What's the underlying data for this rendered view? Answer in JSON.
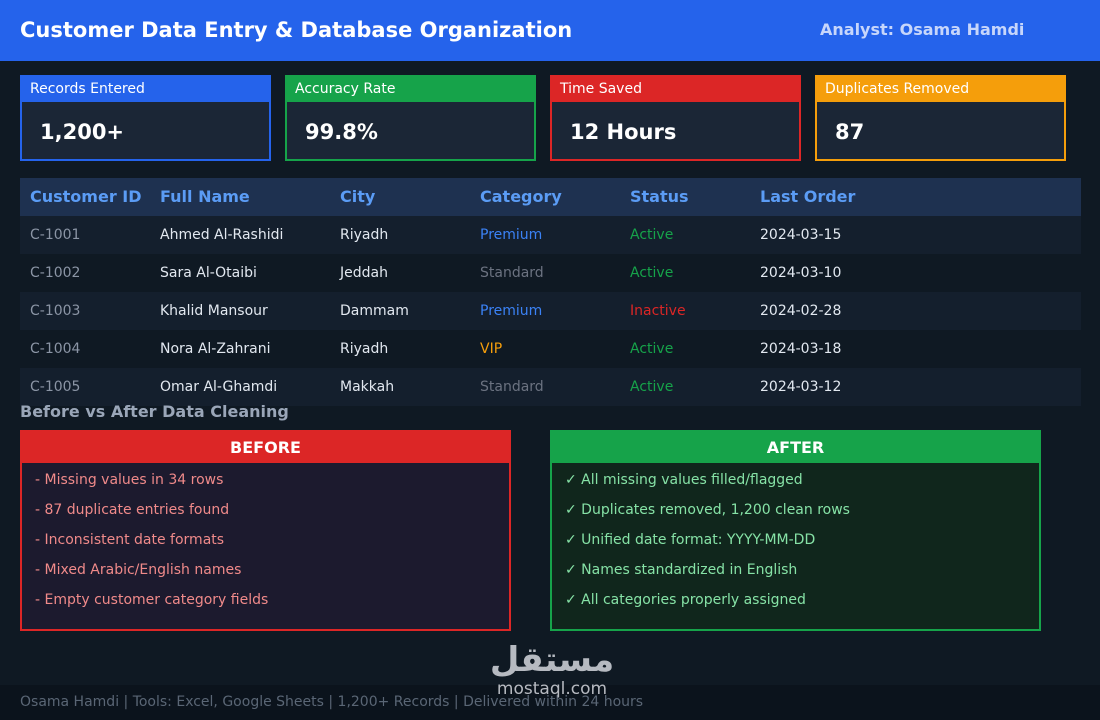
{
  "header": {
    "title": "Customer Data Entry & Database Organization",
    "analyst": "Analyst: Osama Hamdi",
    "color": "#2563eb"
  },
  "stats": [
    {
      "label": "Records Entered",
      "value": "1,200+",
      "color": "#2563eb"
    },
    {
      "label": "Accuracy Rate",
      "value": "99.8%",
      "color": "#16a34a"
    },
    {
      "label": "Time Saved",
      "value": "12 Hours",
      "color": "#dc2626"
    },
    {
      "label": "Duplicates Removed",
      "value": "87",
      "color": "#f59e0b"
    }
  ],
  "table": {
    "columns": [
      "Customer ID",
      "Full Name",
      "City",
      "Category",
      "Status",
      "Last Order"
    ],
    "rows": [
      {
        "id": "C-1001",
        "name": "Ahmed Al-Rashidi",
        "city": "Riyadh",
        "category": "Premium",
        "status": "Active",
        "last_order": "2024-03-15"
      },
      {
        "id": "C-1002",
        "name": "Sara Al-Otaibi",
        "city": "Jeddah",
        "category": "Standard",
        "status": "Active",
        "last_order": "2024-03-10"
      },
      {
        "id": "C-1003",
        "name": "Khalid Mansour",
        "city": "Dammam",
        "category": "Premium",
        "status": "Inactive",
        "last_order": "2024-02-28"
      },
      {
        "id": "C-1004",
        "name": "Nora Al-Zahrani",
        "city": "Riyadh",
        "category": "VIP",
        "status": "Active",
        "last_order": "2024-03-18"
      },
      {
        "id": "C-1005",
        "name": "Omar Al-Ghamdi",
        "city": "Makkah",
        "category": "Standard",
        "status": "Active",
        "last_order": "2024-03-12"
      }
    ]
  },
  "category_colors": {
    "Premium": "#3b82f6",
    "Standard": "#6b7280",
    "VIP": "#f59e0b"
  },
  "status_colors": {
    "Active": "#16a34a",
    "Inactive": "#dc2626"
  },
  "comparison": {
    "title": "Before vs After Data Cleaning",
    "before": {
      "title": "BEFORE",
      "items": [
        "- Missing values in 34 rows",
        "- 87 duplicate entries found",
        "- Inconsistent date formats",
        "- Mixed Arabic/English names",
        "- Empty customer category fields"
      ]
    },
    "after": {
      "title": "AFTER",
      "items": [
        "✓ All missing values filled/flagged",
        "✓ Duplicates removed, 1,200 clean rows",
        "✓ Unified date format: YYYY-MM-DD",
        "✓ Names standardized in English",
        "✓ All categories properly assigned"
      ]
    }
  },
  "watermark": {
    "arabic": "مستقل",
    "latin": "mostaql.com"
  },
  "footer": "Osama Hamdi  |  Tools: Excel, Google Sheets  |  1,200+ Records  |  Delivered within 24 hours"
}
